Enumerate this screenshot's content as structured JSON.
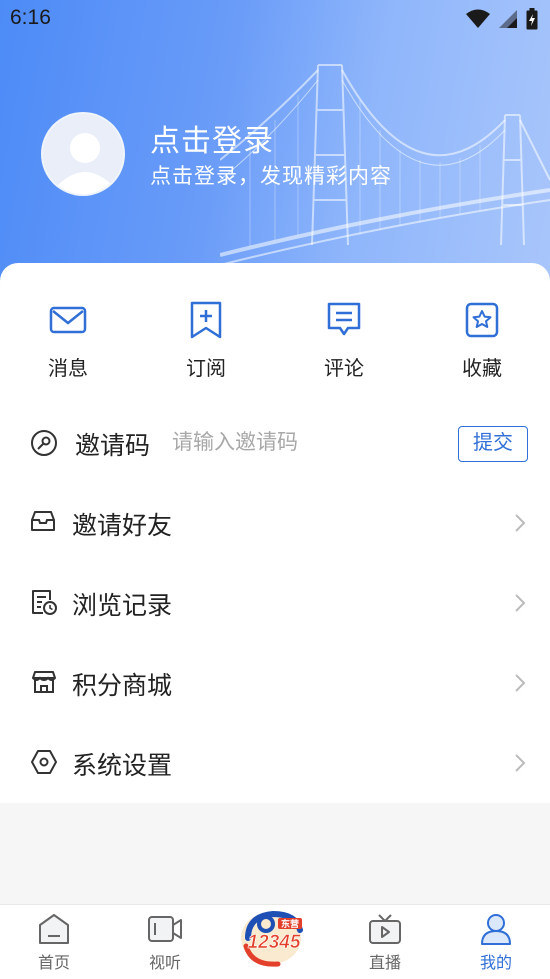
{
  "status_bar": {
    "time": "6:16"
  },
  "profile": {
    "title": "点击登录",
    "subtitle": "点击登录，发现精彩内容"
  },
  "quick_actions": [
    {
      "label": "消息",
      "icon": "mail-icon"
    },
    {
      "label": "订阅",
      "icon": "bookmark-add-icon"
    },
    {
      "label": "评论",
      "icon": "comment-icon"
    },
    {
      "label": "收藏",
      "icon": "star-icon"
    }
  ],
  "invite": {
    "label": "邀请码",
    "placeholder": "请输入邀请码",
    "value": "",
    "submit_label": "提交"
  },
  "menu": [
    {
      "label": "邀请好友",
      "icon": "inbox-icon"
    },
    {
      "label": "浏览记录",
      "icon": "history-doc-icon"
    },
    {
      "label": "积分商城",
      "icon": "store-icon"
    },
    {
      "label": "系统设置",
      "icon": "hexagon-settings-icon"
    }
  ],
  "tabbar": {
    "items": [
      {
        "label": "首页",
        "icon": "home-icon"
      },
      {
        "label": "视听",
        "icon": "video-icon"
      },
      {
        "label": "直播",
        "icon": "tv-icon"
      },
      {
        "label": "我的",
        "icon": "user-icon"
      }
    ],
    "center_logo_text": "12345",
    "center_logo_badge": "东营",
    "active_index": 3
  },
  "colors": {
    "accent": "#2f6fd6",
    "hero_start": "#4d8bf7",
    "hero_end": "#a9c6fb"
  }
}
